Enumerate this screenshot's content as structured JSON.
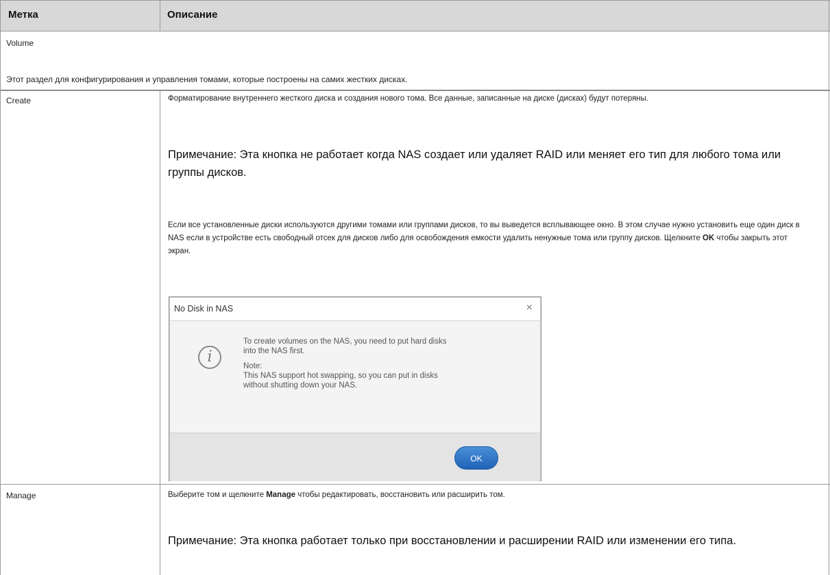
{
  "header": {
    "col_label": "Метка",
    "col_desc": "Описание"
  },
  "section": {
    "title": "Volume",
    "description": "Этот раздел для конфигурирования и управления томами, которые построены на самих жестких дисках."
  },
  "rows": {
    "create": {
      "label": "Create",
      "desc_1": "Форматирование внутреннего жесткого диска и создания нового тома. Все данные, записанные на диске (дисках) будут потеряны.",
      "note": "Примечание: Эта кнопка не работает когда NAS создает или удаляет RAID или меняет его тип для любого тома или группы дисков.",
      "desc_2": "Если все установленные диски используются другими томами или группами дисков, то вы выведется всплывающее окно. В этом случае нужно установить еще один диск в NAS если в устройстве есть свободный отсек для дисков либо для освобождения емкости удалить ненужные тома или группу дисков. Щелкните",
      "desc_2_bold": "OK",
      "desc_2_end": "чтобы закрыть этот экран."
    },
    "manage": {
      "label": "Manage",
      "desc_pre": "Выберите том и щелкните",
      "desc_bold": "Manage",
      "desc_post": "чтобы редактировать, восстановить или расширить том.",
      "note": "Примечание: Эта кнопка работает только при восстановлении и расширении RAID или изменении его типа."
    }
  },
  "dialog": {
    "title": "No Disk in NAS",
    "close_glyph": "×",
    "info_glyph": "i",
    "line1": "To create volumes on the NAS, you need to put hard disks",
    "line2": "into the NAS first.",
    "note_label": "Note:",
    "note_line1": "This NAS support hot swapping, so you can put in disks",
    "note_line2": "without shutting down your NAS.",
    "ok_label": "OK",
    "accent_color": "#1f64b7"
  }
}
